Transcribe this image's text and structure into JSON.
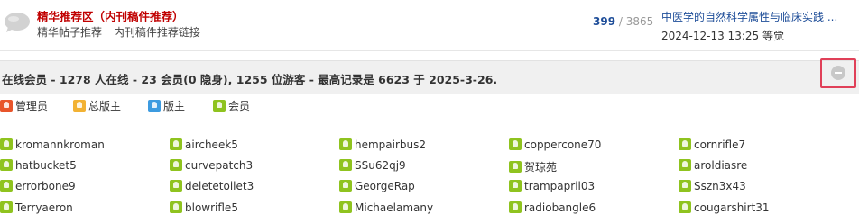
{
  "forum": {
    "title": "精华推荐区（内刊稿件推荐）",
    "links": [
      "精华帖子推荐",
      "内刊稿件推荐链接"
    ],
    "threads": "399",
    "separator": "/",
    "posts": "3865",
    "last_post_title": "中医学的自然科学属性与临床实践 ...",
    "last_post_meta": "2024-12-13 13:25 等觉"
  },
  "online": {
    "summary": "在线会员 - 1278 人在线 - 23 会员(0 隐身), 1255 位游客 - 最高记录是 6623 于 2025-3-26."
  },
  "legend": [
    {
      "label": "管理员",
      "color": "#e8552b"
    },
    {
      "label": "总版主",
      "color": "#f2b233"
    },
    {
      "label": "版主",
      "color": "#3d9be0"
    },
    {
      "label": "会员",
      "color": "#8fc31f"
    }
  ],
  "member_icon_color": "#8fc31f",
  "users": [
    [
      "kromannkroman",
      "aircheek5",
      "hempairbus2",
      "coppercone70",
      "cornrifle7"
    ],
    [
      "hatbucket5",
      "curvepatch3",
      "SSu62qj9",
      "贺琼苑",
      "aroldiasre"
    ],
    [
      "errorbone9",
      "deletetoilet3",
      "GeorgeRap",
      "trampapril03",
      "Sszn3x43"
    ],
    [
      "Terryaeron",
      "blowrifle5",
      "Michaelamany",
      "radiobangle6",
      "cougarshirt31"
    ]
  ]
}
